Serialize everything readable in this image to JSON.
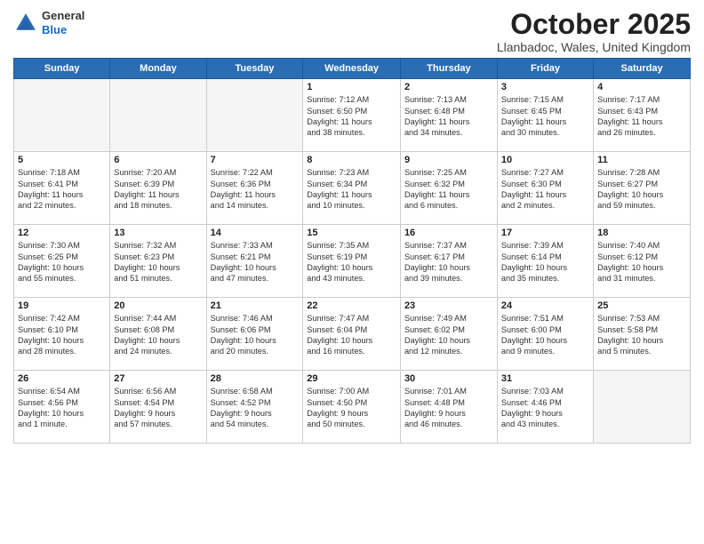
{
  "header": {
    "logo_general": "General",
    "logo_blue": "Blue",
    "month_title": "October 2025",
    "location": "Llanbadoc, Wales, United Kingdom"
  },
  "weekdays": [
    "Sunday",
    "Monday",
    "Tuesday",
    "Wednesday",
    "Thursday",
    "Friday",
    "Saturday"
  ],
  "weeks": [
    [
      {
        "day": "",
        "info": ""
      },
      {
        "day": "",
        "info": ""
      },
      {
        "day": "",
        "info": ""
      },
      {
        "day": "1",
        "info": "Sunrise: 7:12 AM\nSunset: 6:50 PM\nDaylight: 11 hours\nand 38 minutes."
      },
      {
        "day": "2",
        "info": "Sunrise: 7:13 AM\nSunset: 6:48 PM\nDaylight: 11 hours\nand 34 minutes."
      },
      {
        "day": "3",
        "info": "Sunrise: 7:15 AM\nSunset: 6:45 PM\nDaylight: 11 hours\nand 30 minutes."
      },
      {
        "day": "4",
        "info": "Sunrise: 7:17 AM\nSunset: 6:43 PM\nDaylight: 11 hours\nand 26 minutes."
      }
    ],
    [
      {
        "day": "5",
        "info": "Sunrise: 7:18 AM\nSunset: 6:41 PM\nDaylight: 11 hours\nand 22 minutes."
      },
      {
        "day": "6",
        "info": "Sunrise: 7:20 AM\nSunset: 6:39 PM\nDaylight: 11 hours\nand 18 minutes."
      },
      {
        "day": "7",
        "info": "Sunrise: 7:22 AM\nSunset: 6:36 PM\nDaylight: 11 hours\nand 14 minutes."
      },
      {
        "day": "8",
        "info": "Sunrise: 7:23 AM\nSunset: 6:34 PM\nDaylight: 11 hours\nand 10 minutes."
      },
      {
        "day": "9",
        "info": "Sunrise: 7:25 AM\nSunset: 6:32 PM\nDaylight: 11 hours\nand 6 minutes."
      },
      {
        "day": "10",
        "info": "Sunrise: 7:27 AM\nSunset: 6:30 PM\nDaylight: 11 hours\nand 2 minutes."
      },
      {
        "day": "11",
        "info": "Sunrise: 7:28 AM\nSunset: 6:27 PM\nDaylight: 10 hours\nand 59 minutes."
      }
    ],
    [
      {
        "day": "12",
        "info": "Sunrise: 7:30 AM\nSunset: 6:25 PM\nDaylight: 10 hours\nand 55 minutes."
      },
      {
        "day": "13",
        "info": "Sunrise: 7:32 AM\nSunset: 6:23 PM\nDaylight: 10 hours\nand 51 minutes."
      },
      {
        "day": "14",
        "info": "Sunrise: 7:33 AM\nSunset: 6:21 PM\nDaylight: 10 hours\nand 47 minutes."
      },
      {
        "day": "15",
        "info": "Sunrise: 7:35 AM\nSunset: 6:19 PM\nDaylight: 10 hours\nand 43 minutes."
      },
      {
        "day": "16",
        "info": "Sunrise: 7:37 AM\nSunset: 6:17 PM\nDaylight: 10 hours\nand 39 minutes."
      },
      {
        "day": "17",
        "info": "Sunrise: 7:39 AM\nSunset: 6:14 PM\nDaylight: 10 hours\nand 35 minutes."
      },
      {
        "day": "18",
        "info": "Sunrise: 7:40 AM\nSunset: 6:12 PM\nDaylight: 10 hours\nand 31 minutes."
      }
    ],
    [
      {
        "day": "19",
        "info": "Sunrise: 7:42 AM\nSunset: 6:10 PM\nDaylight: 10 hours\nand 28 minutes."
      },
      {
        "day": "20",
        "info": "Sunrise: 7:44 AM\nSunset: 6:08 PM\nDaylight: 10 hours\nand 24 minutes."
      },
      {
        "day": "21",
        "info": "Sunrise: 7:46 AM\nSunset: 6:06 PM\nDaylight: 10 hours\nand 20 minutes."
      },
      {
        "day": "22",
        "info": "Sunrise: 7:47 AM\nSunset: 6:04 PM\nDaylight: 10 hours\nand 16 minutes."
      },
      {
        "day": "23",
        "info": "Sunrise: 7:49 AM\nSunset: 6:02 PM\nDaylight: 10 hours\nand 12 minutes."
      },
      {
        "day": "24",
        "info": "Sunrise: 7:51 AM\nSunset: 6:00 PM\nDaylight: 10 hours\nand 9 minutes."
      },
      {
        "day": "25",
        "info": "Sunrise: 7:53 AM\nSunset: 5:58 PM\nDaylight: 10 hours\nand 5 minutes."
      }
    ],
    [
      {
        "day": "26",
        "info": "Sunrise: 6:54 AM\nSunset: 4:56 PM\nDaylight: 10 hours\nand 1 minute."
      },
      {
        "day": "27",
        "info": "Sunrise: 6:56 AM\nSunset: 4:54 PM\nDaylight: 9 hours\nand 57 minutes."
      },
      {
        "day": "28",
        "info": "Sunrise: 6:58 AM\nSunset: 4:52 PM\nDaylight: 9 hours\nand 54 minutes."
      },
      {
        "day": "29",
        "info": "Sunrise: 7:00 AM\nSunset: 4:50 PM\nDaylight: 9 hours\nand 50 minutes."
      },
      {
        "day": "30",
        "info": "Sunrise: 7:01 AM\nSunset: 4:48 PM\nDaylight: 9 hours\nand 46 minutes."
      },
      {
        "day": "31",
        "info": "Sunrise: 7:03 AM\nSunset: 4:46 PM\nDaylight: 9 hours\nand 43 minutes."
      },
      {
        "day": "",
        "info": ""
      }
    ]
  ]
}
